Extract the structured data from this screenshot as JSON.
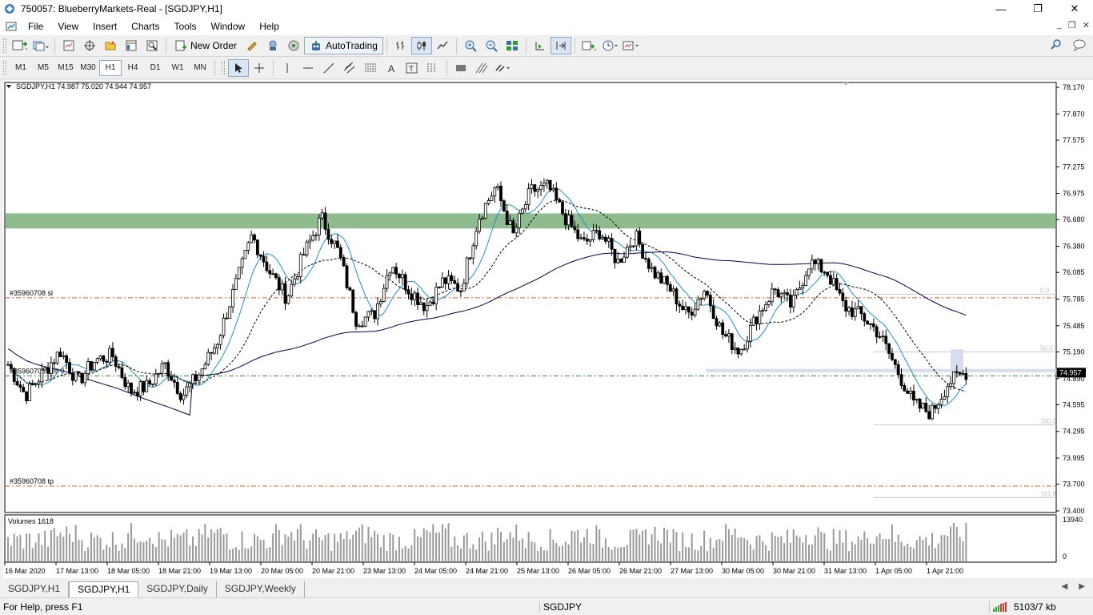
{
  "window": {
    "title": "750057: BlueberryMarkets-Real - [SGDJPY,H1]"
  },
  "menu": [
    "File",
    "View",
    "Insert",
    "Charts",
    "Tools",
    "Window",
    "Help"
  ],
  "toolbar": {
    "new_order": "New Order",
    "autotrading": "AutoTrading"
  },
  "timeframes": [
    "M1",
    "M5",
    "M15",
    "M30",
    "H1",
    "H4",
    "D1",
    "W1",
    "MN"
  ],
  "active_timeframe": "H1",
  "chart": {
    "header": "SGDJPY,H1  74.987 75.020 74.944 74.957",
    "price_labels": [
      "78.170",
      "77.870",
      "77.575",
      "77.275",
      "76.975",
      "76.680",
      "76.380",
      "76.085",
      "75.785",
      "75.485",
      "75.190",
      "74.890",
      "74.595",
      "74.295",
      "73.995",
      "73.700",
      "73.400"
    ],
    "current_price": "74.957",
    "sl_label": "#35960708 sl",
    "sell_label": "#35960708 sell 0",
    "tp_label": "#35960708 tp",
    "fib_labels": [
      "0.0",
      "50.0",
      "100.0",
      "161.8"
    ],
    "time_labels": [
      "16 Mar 2020",
      "17 Mar 13:00",
      "18 Mar 05:00",
      "18 Mar 21:00",
      "19 Mar 13:00",
      "20 Mar 05:00",
      "20 Mar 21:00",
      "23 Mar 13:00",
      "24 Mar 05:00",
      "24 Mar 21:00",
      "25 Mar 13:00",
      "26 Mar 05:00",
      "26 Mar 21:00",
      "27 Mar 13:00",
      "30 Mar 05:00",
      "30 Mar 21:00",
      "31 Mar 13:00",
      "1 Apr 05:00",
      "1 Apr 21:00"
    ],
    "volumes_label": "Volumes 1618",
    "volume_scale": [
      "13940",
      "0"
    ],
    "colors": {
      "zone": "#8fbc8f",
      "sl_tp": "#d2691e",
      "entry": "#2e8b2e",
      "ma_fast": "#1e90c8",
      "ma_slow": "#000050"
    }
  },
  "chart_data": {
    "type": "candlestick",
    "symbol": "SGDJPY",
    "timeframe": "H1",
    "ylim": [
      73.4,
      78.17
    ],
    "ohlc_last": {
      "open": 74.987,
      "high": 75.02,
      "low": 74.944,
      "close": 74.957
    },
    "path": [
      75.05,
      74.7,
      74.95,
      75.2,
      74.85,
      75.1,
      75.15,
      74.75,
      74.8,
      75.05,
      74.7,
      74.95,
      75.3,
      75.9,
      76.5,
      76.1,
      75.8,
      76.3,
      76.7,
      76.3,
      75.55,
      75.6,
      76.2,
      75.9,
      75.7,
      76.0,
      75.9,
      76.7,
      77.05,
      76.5,
      77.0,
      77.05,
      76.7,
      76.4,
      76.55,
      76.2,
      76.5,
      76.1,
      75.9,
      75.6,
      75.9,
      75.4,
      75.2,
      75.6,
      75.9,
      75.7,
      76.2,
      76.1,
      75.7,
      75.6,
      75.4,
      75.0,
      74.6,
      74.5,
      74.85,
      74.96
    ]
  },
  "tabs": [
    "SGDJPY,H1",
    "SGDJPY,H1",
    "SGDJPY,Daily",
    "SGDJPY,Weekly"
  ],
  "active_tab_index": 1,
  "status": {
    "help": "For Help, press F1",
    "symbol": "SGDJPY",
    "connection": "5103/7 kb"
  }
}
